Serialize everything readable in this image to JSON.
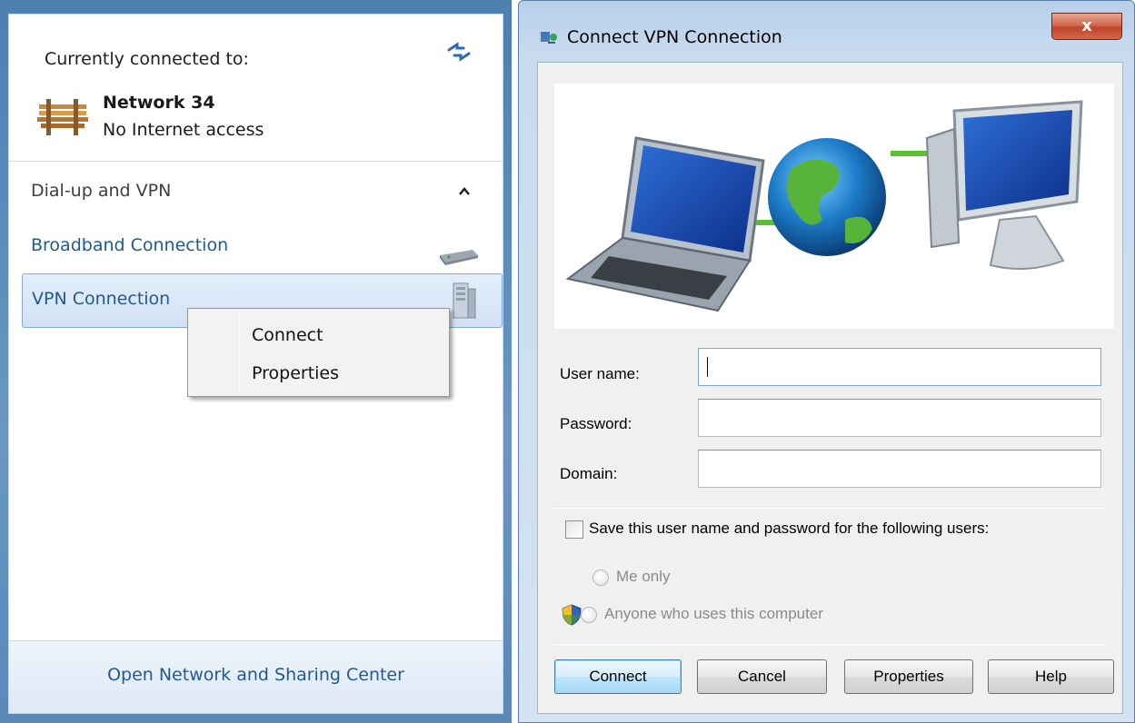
{
  "flyout": {
    "connected_header": "Currently connected to:",
    "network": {
      "name": "Network  34",
      "status": "No Internet access"
    },
    "section_title": "Dial-up and VPN",
    "connections": [
      {
        "label": "Broadband Connection",
        "icon": "modem-icon"
      },
      {
        "label": "VPN Connection",
        "icon": "vpn-server-icon",
        "selected": true
      }
    ],
    "context_menu": {
      "items": [
        "Connect",
        "Properties"
      ]
    },
    "footer_link": "Open Network and Sharing Center"
  },
  "dialog": {
    "title": "Connect VPN Connection",
    "close_label": "x",
    "fields": {
      "username": {
        "label": "User name:",
        "value": ""
      },
      "password": {
        "label": "Password:",
        "value": ""
      },
      "domain": {
        "label": "Domain:",
        "value": ""
      }
    },
    "save_checkbox": {
      "label": "Save this user name and password for the following users:",
      "checked": false
    },
    "radios": [
      {
        "label": "Me only",
        "enabled": false
      },
      {
        "label": "Anyone who uses this computer",
        "enabled": false
      }
    ],
    "buttons": {
      "connect": "Connect",
      "cancel": "Cancel",
      "properties": "Properties",
      "help": "Help"
    }
  },
  "colors": {
    "link_blue": "#1f5a92",
    "selection_border": "#86aad8",
    "frame_blue": "#5a88b8"
  }
}
